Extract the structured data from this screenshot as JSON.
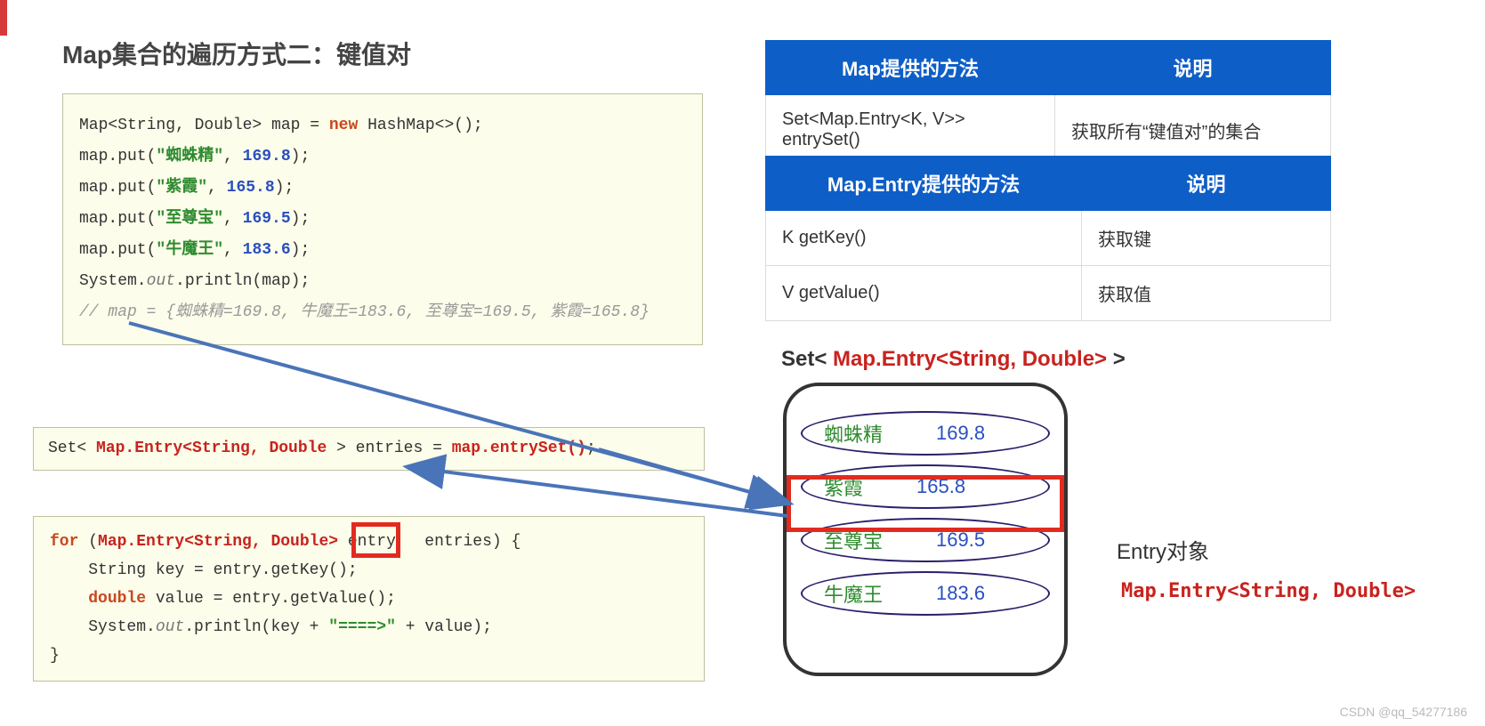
{
  "title": "Map集合的遍历方式二：键值对",
  "code1_lines": [
    {
      "t": "plain",
      "v": "Map<String, Double> map = "
    },
    {
      "t": "kw",
      "v": "new"
    },
    {
      "t": "plain",
      "v": " HashMap<>();"
    },
    {
      "t": "nl"
    },
    {
      "t": "plain",
      "v": "map.put("
    },
    {
      "t": "str",
      "v": "\"蜘蛛精\""
    },
    {
      "t": "plain",
      "v": ", "
    },
    {
      "t": "num",
      "v": "169.8"
    },
    {
      "t": "plain",
      "v": ");"
    },
    {
      "t": "nl"
    },
    {
      "t": "plain",
      "v": "map.put("
    },
    {
      "t": "str",
      "v": "\"紫霞\""
    },
    {
      "t": "plain",
      "v": ", "
    },
    {
      "t": "num",
      "v": "165.8"
    },
    {
      "t": "plain",
      "v": ");"
    },
    {
      "t": "nl"
    },
    {
      "t": "plain",
      "v": "map.put("
    },
    {
      "t": "str",
      "v": "\"至尊宝\""
    },
    {
      "t": "plain",
      "v": ", "
    },
    {
      "t": "num",
      "v": "169.5"
    },
    {
      "t": "plain",
      "v": ");"
    },
    {
      "t": "nl"
    },
    {
      "t": "plain",
      "v": "map.put("
    },
    {
      "t": "str",
      "v": "\"牛魔王\""
    },
    {
      "t": "plain",
      "v": ", "
    },
    {
      "t": "num",
      "v": "183.6"
    },
    {
      "t": "plain",
      "v": ");"
    },
    {
      "t": "nl"
    },
    {
      "t": "plain",
      "v": "System."
    },
    {
      "t": "it",
      "v": "out"
    },
    {
      "t": "plain",
      "v": ".println(map);"
    },
    {
      "t": "nl"
    },
    {
      "t": "cmt",
      "v": "// map = {蜘蛛精=169.8, 牛魔王=183.6, 至尊宝=169.5, 紫霞=165.8}"
    }
  ],
  "code2_lines": [
    {
      "t": "plain",
      "v": "Set< "
    },
    {
      "t": "red",
      "v": "Map.Entry<String, Double"
    },
    {
      "t": "plain",
      "v": " > entries = "
    },
    {
      "t": "red",
      "v": "map.entrySet()"
    },
    {
      "t": "plain",
      "v": ";"
    }
  ],
  "code3_lines": [
    {
      "t": "kw",
      "v": "for"
    },
    {
      "t": "plain",
      "v": " ("
    },
    {
      "t": "red",
      "v": "Map.Entry<String, Double>"
    },
    {
      "t": "plain",
      "v": " entry   entries) {"
    },
    {
      "t": "nl"
    },
    {
      "t": "plain",
      "v": "    String key = entry.getKey();"
    },
    {
      "t": "nl"
    },
    {
      "t": "plain",
      "v": "    "
    },
    {
      "t": "kw",
      "v": "double"
    },
    {
      "t": "plain",
      "v": " value = entry.getValue();"
    },
    {
      "t": "nl"
    },
    {
      "t": "plain",
      "v": "    System."
    },
    {
      "t": "it",
      "v": "out"
    },
    {
      "t": "plain",
      "v": ".println(key + "
    },
    {
      "t": "str",
      "v": "\"====>\""
    },
    {
      "t": "plain",
      "v": " + value);"
    },
    {
      "t": "nl"
    },
    {
      "t": "plain",
      "v": "}"
    }
  ],
  "table1": {
    "headers": [
      "Map提供的方法",
      "说明"
    ],
    "rows": [
      [
        "Set<Map.Entry<K, V>> entrySet()",
        "获取所有“键值对”的集合"
      ]
    ]
  },
  "table2": {
    "headers": [
      "Map.Entry提供的方法",
      "说明"
    ],
    "rows": [
      [
        "K  getKey()",
        "获取键"
      ],
      [
        "V  getValue()",
        "获取值"
      ]
    ]
  },
  "set_title_prefix": "Set< ",
  "set_title_mid": "Map.Entry<String, Double>",
  "set_title_suffix": " >",
  "entries": [
    {
      "k": "蜘蛛精",
      "v": "169.8"
    },
    {
      "k": "紫霞",
      "v": "165.8"
    },
    {
      "k": "至尊宝",
      "v": "169.5"
    },
    {
      "k": "牛魔王",
      "v": "183.6"
    }
  ],
  "entry_label": "Entry对象",
  "entry_type": "Map.Entry<String, Double>",
  "watermark": "CSDN @qq_54277186"
}
